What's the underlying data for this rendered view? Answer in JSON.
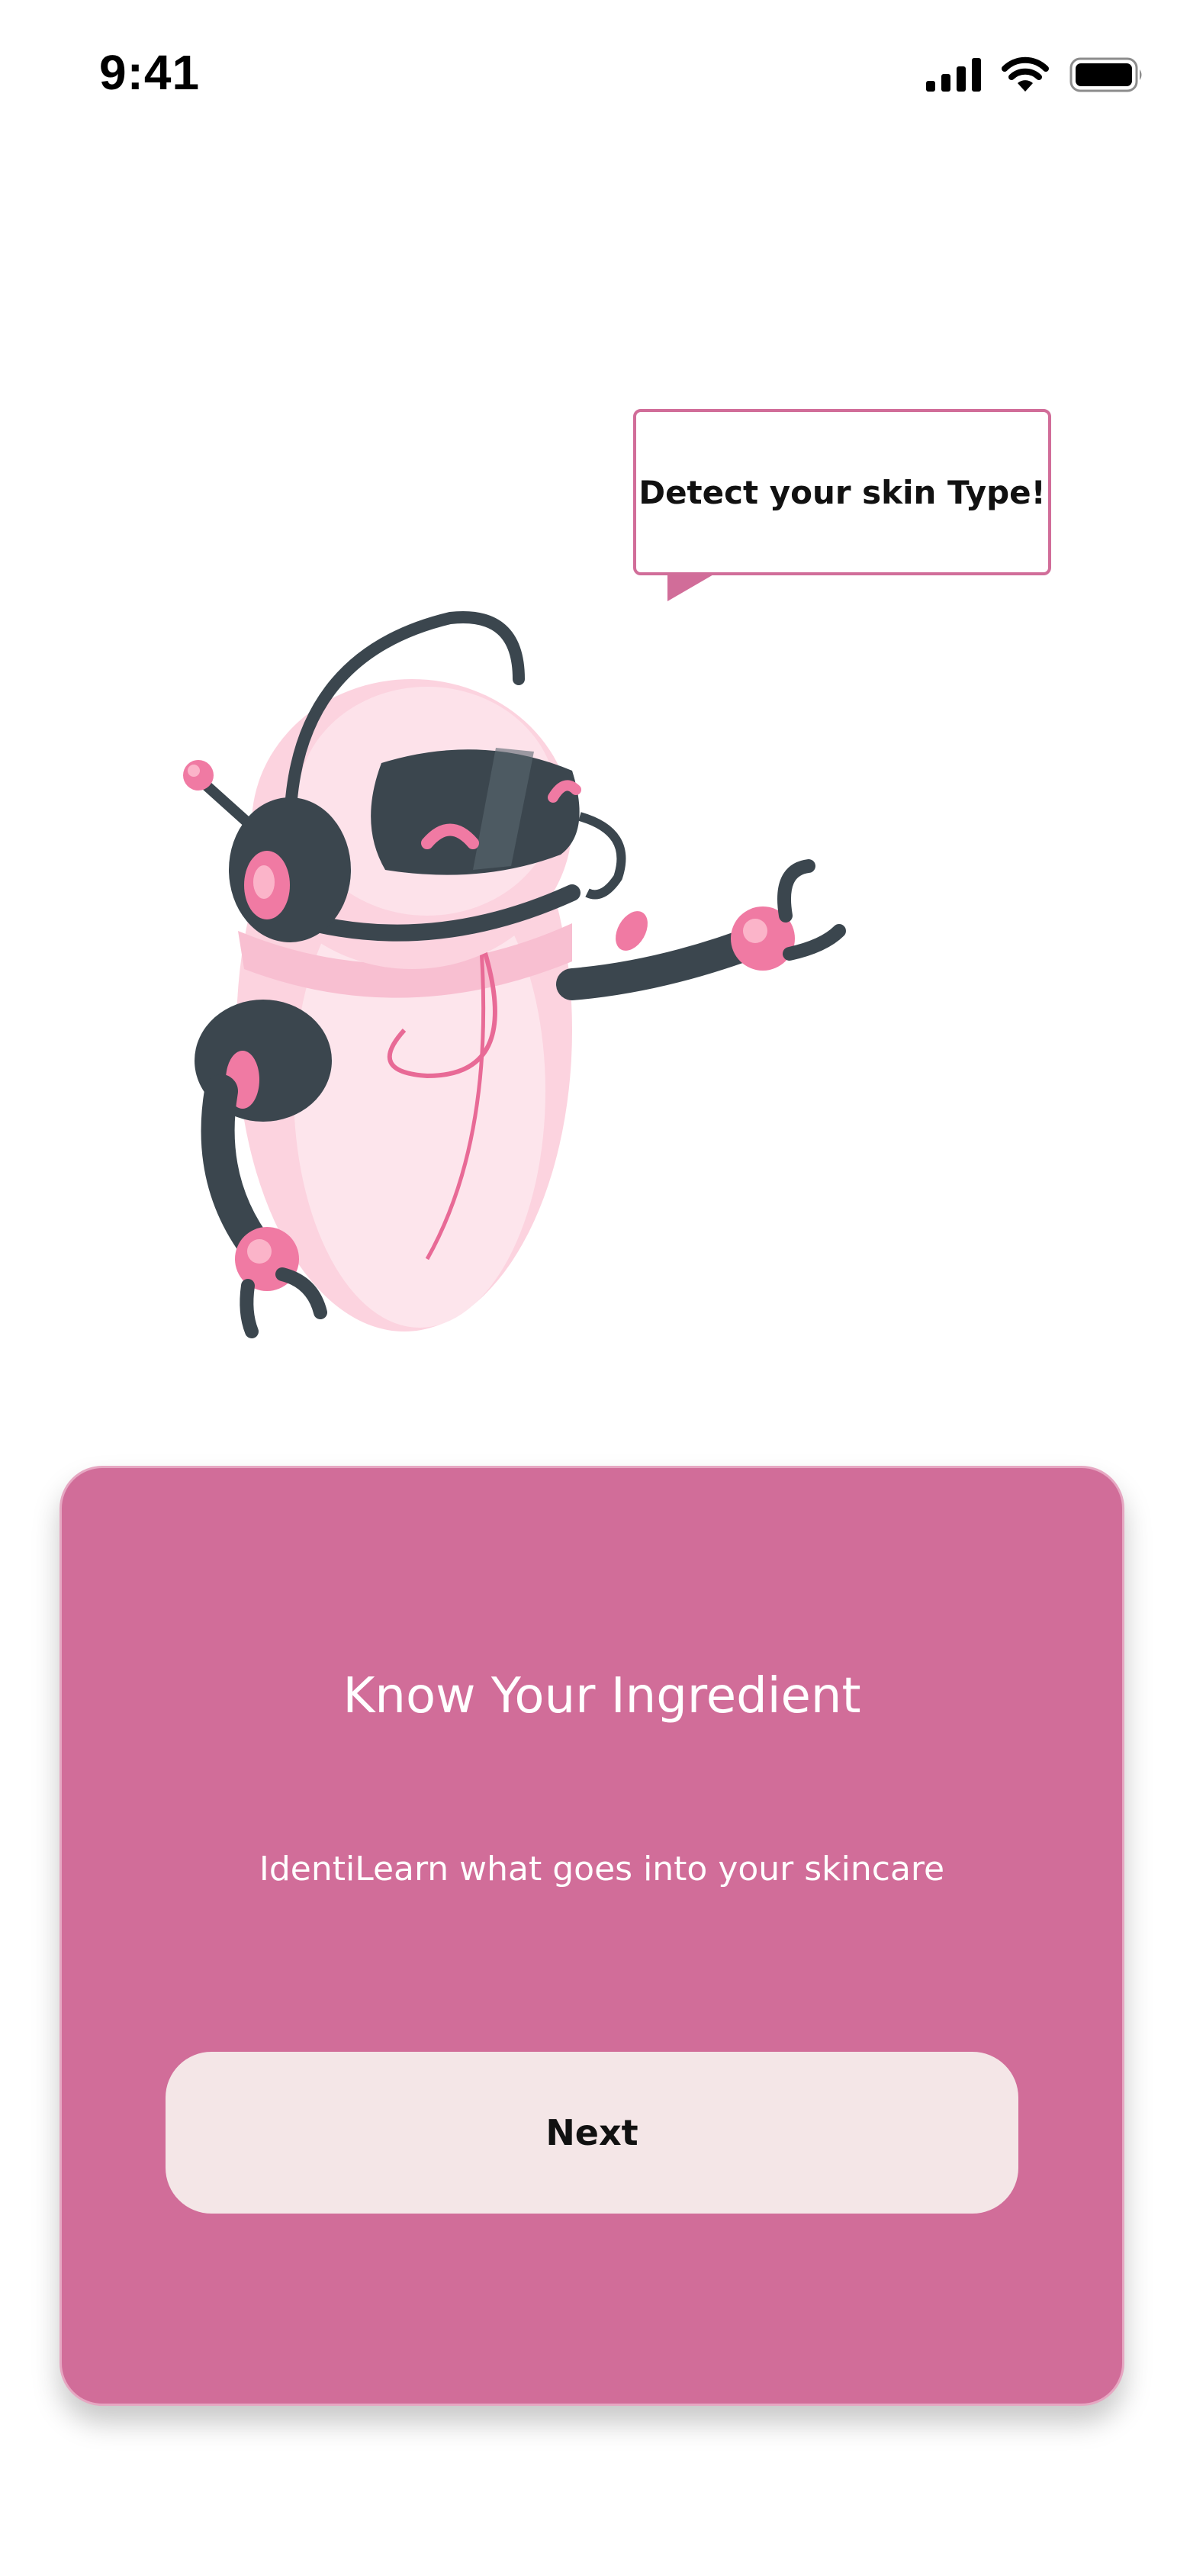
{
  "status_bar": {
    "time": "9:41",
    "icons": [
      "cellular-signal-icon",
      "wifi-icon",
      "battery-icon"
    ]
  },
  "illustration": {
    "bubble_text": "Detect your skin Type!",
    "image": "robot-illustration"
  },
  "card": {
    "title": "Know Your Ingredient",
    "subtitle": "IdentiLearn what goes into your skincare",
    "next_label": "Next"
  },
  "colors": {
    "accent": "#d16d99",
    "button_bg": "#f4e6e7",
    "robot_pink": "#fcd3df",
    "robot_dark": "#3b464e"
  }
}
